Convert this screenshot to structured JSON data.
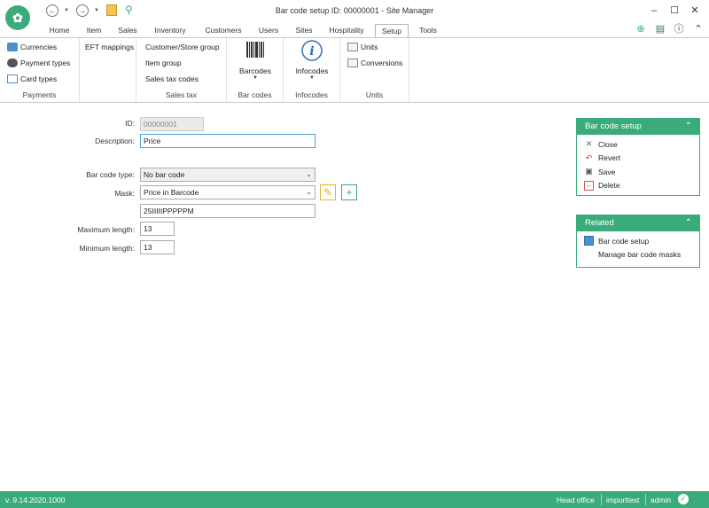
{
  "window": {
    "title": "Bar code setup ID: 00000001 - Site Manager"
  },
  "tabs": [
    "Home",
    "Item",
    "Sales",
    "Inventory",
    "Customers",
    "Users",
    "Sites",
    "Hospitality",
    "Setup",
    "Tools"
  ],
  "active_tab": "Setup",
  "ribbon": {
    "payments": {
      "items": [
        "Currencies",
        "Payment types",
        "Card types"
      ],
      "label": "Payments"
    },
    "eft": {
      "items": [
        "EFT mappings"
      ]
    },
    "sales_tax": {
      "items": [
        "Customer/Store group",
        "Item group",
        "Sales tax codes"
      ],
      "label": "Sales tax"
    },
    "bar_codes": {
      "button": "Barcodes",
      "label": "Bar codes"
    },
    "infocodes": {
      "button": "Infocodes",
      "label": "Infocodes"
    },
    "units": {
      "items": [
        "Units",
        "Conversions"
      ],
      "label": "Units"
    }
  },
  "form": {
    "id_label": "ID:",
    "id_value": "00000001",
    "description_label": "Description:",
    "description_value": "Price",
    "barcode_type_label": "Bar code type:",
    "barcode_type_value": "No bar code",
    "mask_label": "Mask:",
    "mask_value": "Price in Barcode",
    "mask_pattern": "25IIIIIPPPPPM",
    "max_length_label": "Maximum length:",
    "max_length_value": "13",
    "min_length_label": "Minimum length:",
    "min_length_value": "13"
  },
  "panels": {
    "setup": {
      "title": "Bar code setup",
      "items": [
        "Close",
        "Revert",
        "Save",
        "Delete"
      ]
    },
    "related": {
      "title": "Related",
      "items": [
        "Bar code setup",
        "Manage bar code masks"
      ]
    }
  },
  "status": {
    "version": "v. 9.14.2020.1000",
    "store": "Head office",
    "database": "importtest",
    "user": "admin"
  },
  "colors": {
    "accent": "#3bab7c",
    "focus": "#4aa3d9"
  }
}
